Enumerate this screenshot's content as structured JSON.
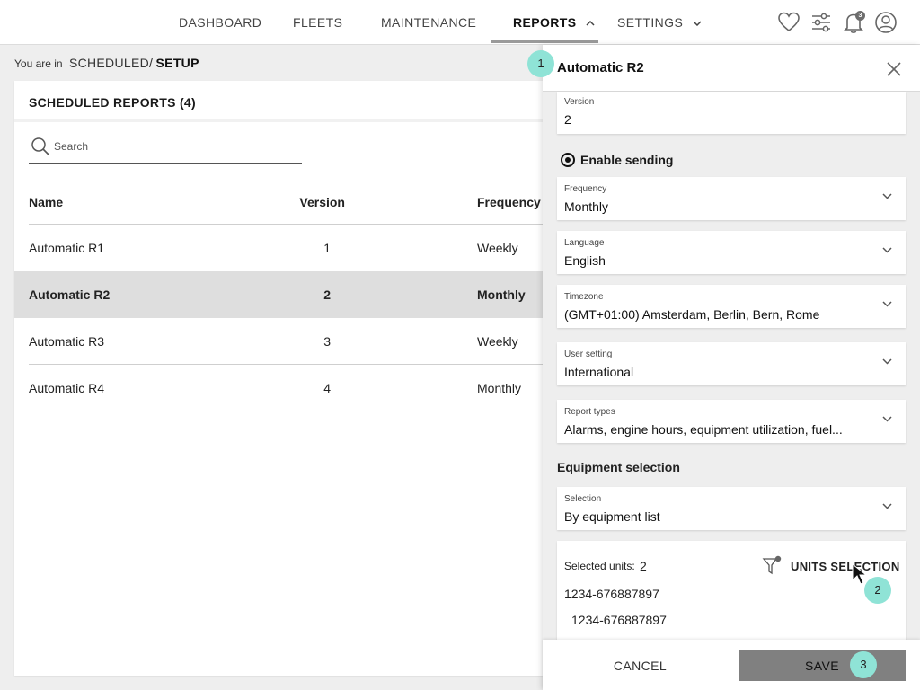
{
  "nav": {
    "items": [
      {
        "label": "DASHBOARD"
      },
      {
        "label": "FLEETS"
      },
      {
        "label": "MAINTENANCE"
      },
      {
        "label": "REPORTS"
      },
      {
        "label": "SETTINGS"
      }
    ],
    "active": "REPORTS",
    "icons": [
      "heart-icon",
      "sliders-icon",
      "bell-icon",
      "user-icon"
    ],
    "notification_count": "3"
  },
  "breadcrumb": {
    "prefix": "You are in",
    "path": "SCHEDULED/",
    "current": "SETUP"
  },
  "reports_list": {
    "title": "SCHEDULED REPORTS (4)",
    "search_placeholder": "Search",
    "columns": {
      "name": "Name",
      "version": "Version",
      "frequency": "Frequency"
    },
    "rows": [
      {
        "name": "Automatic R1",
        "version": "1",
        "frequency": "Weekly"
      },
      {
        "name": "Automatic R2",
        "version": "2",
        "frequency": "Monthly",
        "selected": true
      },
      {
        "name": "Automatic R3",
        "version": "3",
        "frequency": "Weekly"
      },
      {
        "name": "Automatic R4",
        "version": "4",
        "frequency": "Monthly"
      }
    ]
  },
  "panel": {
    "title": "Automatic R2",
    "fields": {
      "version": {
        "label": "Version",
        "value": "2"
      },
      "enable_sending": {
        "label": "Enable sending",
        "checked": true
      },
      "frequency": {
        "label": "Frequency",
        "value": "Monthly"
      },
      "language": {
        "label": "Language",
        "value": "English"
      },
      "timezone": {
        "label": "Timezone",
        "value": "(GMT+01:00) Amsterdam, Berlin, Bern, Rome"
      },
      "user_setting": {
        "label": "User setting",
        "value": "International"
      },
      "report_types": {
        "label": "Report types",
        "value": "Alarms, engine hours, equipment utilization, fuel..."
      }
    },
    "equipment_selection": {
      "title": "Equipment selection",
      "selection": {
        "label": "Selection",
        "value": "By equipment list"
      },
      "selected_units_label": "Selected units:",
      "selected_units_count": "2",
      "units_button": "UNITS SELECTION",
      "units": [
        "1234-676887897",
        "1234-676887897"
      ]
    },
    "footer": {
      "cancel": "CANCEL",
      "save": "SAVE"
    }
  },
  "step_markers": [
    "1",
    "2",
    "3"
  ],
  "colors": {
    "step_marker": "#8fe3d6",
    "save_button": "#808080",
    "selected_row": "#dedede"
  }
}
